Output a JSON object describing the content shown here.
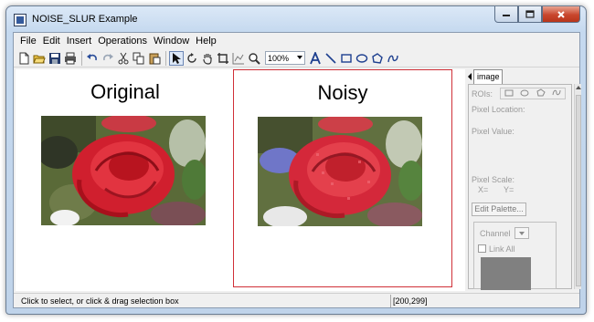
{
  "window": {
    "title": "NOISE_SLUR Example"
  },
  "menu": {
    "items": [
      "File",
      "Edit",
      "Insert",
      "Operations",
      "Window",
      "Help"
    ]
  },
  "toolbar": {
    "zoom": "100%",
    "icons": [
      "new-file-icon",
      "open-folder-icon",
      "save-icon",
      "print-icon",
      "undo-icon",
      "redo-icon",
      "cut-icon",
      "copy-icon",
      "paste-icon",
      "select-arrow-icon",
      "rotate-icon",
      "pan-hand-icon",
      "crop-icon",
      "plot-icon",
      "zoom-icon",
      "text-icon",
      "line-icon",
      "rectangle-icon",
      "ellipse-icon",
      "polygon-icon",
      "freehand-icon"
    ]
  },
  "panels": [
    {
      "title": "Original"
    },
    {
      "title": "Noisy"
    }
  ],
  "sidebar": {
    "tab": "image",
    "rois_label": "ROIs:",
    "pixel_location": "Pixel Location:",
    "pixel_value": "Pixel Value:",
    "pixel_scale": "Pixel Scale:",
    "x_label": "X=",
    "y_label": "Y=",
    "edit_palette": "Edit Palette...",
    "channel_label": "Channel",
    "link_all": "Link All"
  },
  "status": {
    "message": "Click to select, or click & drag selection box",
    "coordinates": "[200,299]"
  }
}
